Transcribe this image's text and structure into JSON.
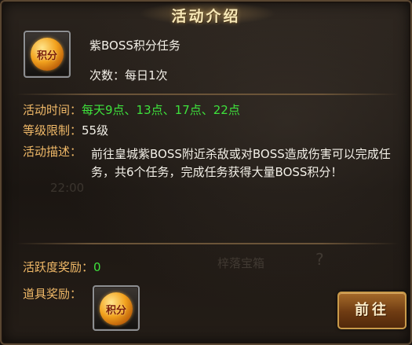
{
  "dialog": {
    "title": "活动介绍",
    "event_name": "紫BOSS积分任务",
    "count_label": "次数：每日1次",
    "icon_text": "积分"
  },
  "details": {
    "time_label": "活动时间：",
    "time_value": "每天9点、13点、17点、22点",
    "level_label": "等级限制：",
    "level_value": "55级",
    "desc_label": "活动描述：",
    "desc_value": "前往皇城紫BOSS附近杀敌或对BOSS造成伤害可以完成任务，共6个任务，完成任务获得大量BOSS积分！"
  },
  "rewards": {
    "activity_label": "活跃度奖励：",
    "activity_value": "0",
    "item_label": "道具奖励：",
    "item_icon_text": "积分"
  },
  "actions": {
    "go_label": "前往"
  },
  "background": {
    "time_text": "22:00",
    "faded_text": "梓落宝箱",
    "question_mark": "?"
  },
  "colors": {
    "label": "#f0b968",
    "highlight_green": "#3ee13c",
    "text": "#f3f0e8"
  }
}
